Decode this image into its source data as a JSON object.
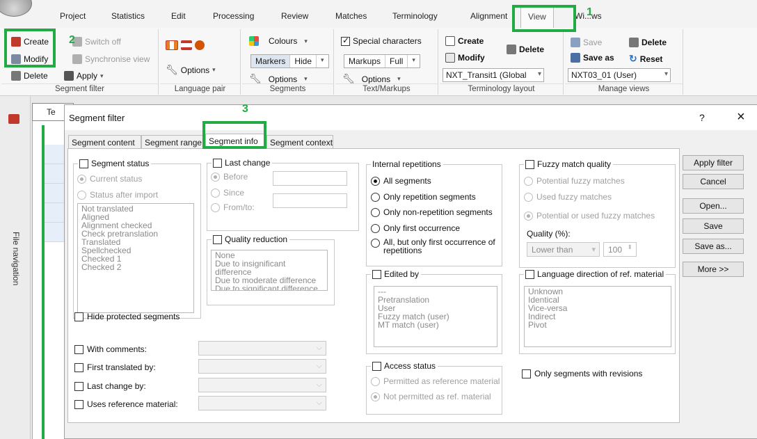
{
  "ribbon_tabs": [
    "Project",
    "Statistics",
    "Edit",
    "Processing",
    "Review",
    "Matches",
    "Terminology",
    "Alignment",
    "View",
    "Wi...ws"
  ],
  "ribbon_active_tab": "View",
  "groups": {
    "segment_filter": {
      "label": "Segment filter",
      "create": "Create",
      "switch_off": "Switch off",
      "modify": "Modify",
      "synchronise": "Synchronise view",
      "delete": "Delete",
      "apply": "Apply"
    },
    "language_pair": {
      "label": "Language pair",
      "options": "Options"
    },
    "segments": {
      "label": "Segments",
      "colours": "Colours",
      "markers": "Markers",
      "hide": "Hide",
      "options": "Options"
    },
    "text_markups": {
      "label": "Text/Markups",
      "special_chars": "Special characters",
      "markups": "Markups",
      "full": "Full",
      "options": "Options"
    },
    "terminology_layout": {
      "label": "Terminology layout",
      "create": "Create",
      "modify": "Modify",
      "delete": "Delete",
      "layout_value": "NXT_Transit1 (Global"
    },
    "manage_views": {
      "label": "Manage views",
      "save": "Save",
      "delete": "Delete",
      "save_as": "Save as",
      "reset": "Reset",
      "view_value": "NXT03_01 (User)"
    }
  },
  "left_panel": {
    "label": "File navigation",
    "doc_tab": "Te"
  },
  "dialog": {
    "title": "Segment filter",
    "help": "?",
    "close": "×",
    "tabs": [
      "Segment content",
      "Segment range",
      "Segment info",
      "Segment context"
    ],
    "active_tab": "Segment info",
    "segment_status": {
      "label": "Segment status",
      "current": "Current status",
      "after_import": "Status after import",
      "items": [
        "Not translated",
        "Aligned",
        "Alignment checked",
        "Check pretranslation",
        "Translated",
        "Spellchecked",
        "Checked 1",
        "Checked 2"
      ]
    },
    "last_change": {
      "label": "Last change",
      "before": "Before",
      "since": "Since",
      "from_to": "From/to:"
    },
    "quality_reduction": {
      "label": "Quality reduction",
      "items": [
        "None",
        "Due to insignificant difference",
        "Due to moderate difference",
        "Due to significant difference"
      ]
    },
    "internal_repetitions": {
      "label": "Internal repetitions",
      "options": [
        "All segments",
        "Only repetition segments",
        "Only non-repetition segments",
        "Only first occurrence",
        "All, but only first occurrence of repetitions"
      ]
    },
    "fuzzy_match_quality": {
      "label": "Fuzzy match quality",
      "options": [
        "Potential fuzzy matches",
        "Used fuzzy matches",
        "Potential or used fuzzy matches"
      ],
      "quality_label": "Quality (%):",
      "comparator": "Lower than",
      "quality_value": "100"
    },
    "edited_by": {
      "label": "Edited by",
      "items": [
        "---",
        "Pretranslation",
        "User",
        "Fuzzy match (user)",
        "MT match (user)"
      ]
    },
    "language_direction": {
      "label": "Language direction of ref. material",
      "items": [
        "Unknown",
        "Identical",
        "Vice-versa",
        "Indirect",
        "Pivot"
      ]
    },
    "hide_protected": "Hide protected segments",
    "with_comments": "With comments:",
    "first_translated_by": "First translated by:",
    "last_change_by": "Last change by:",
    "uses_reference": "Uses reference material:",
    "access_status": {
      "label": "Access status",
      "permitted": "Permitted as reference material",
      "not_permitted": "Not permitted as ref. material"
    },
    "only_revisions": "Only segments with revisions",
    "buttons": {
      "apply": "Apply filter",
      "cancel": "Cancel",
      "open": "Open...",
      "save": "Save",
      "save_as": "Save as...",
      "more": "More >>"
    }
  },
  "callouts": [
    "1",
    "2",
    "3"
  ],
  "colors": {
    "callout": "#22aa44",
    "ribbon_bg": "#f7f7f7",
    "dialog_bg": "#f0f0f0"
  }
}
